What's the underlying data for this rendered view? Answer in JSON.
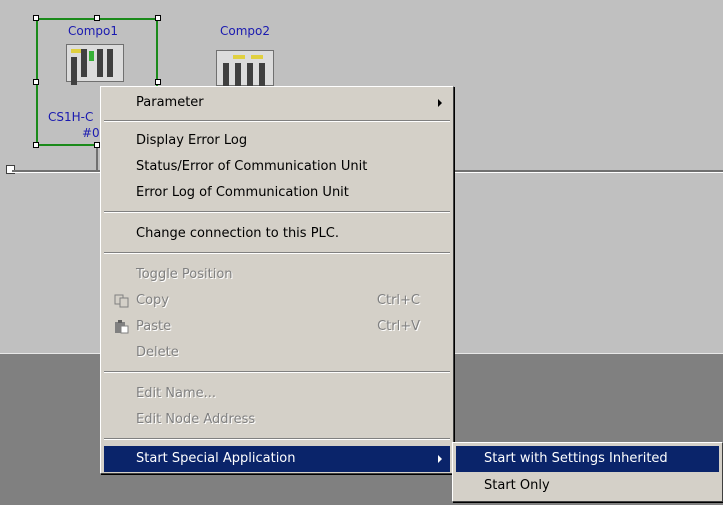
{
  "nodes": {
    "compo1": {
      "name": "Compo1",
      "model": "CS1H-C",
      "address": "#0"
    },
    "compo2": {
      "name": "Compo2"
    }
  },
  "context_menu": {
    "items": [
      {
        "label": "Parameter",
        "submenu": true,
        "enabled": true
      },
      {
        "label": "Display Error Log",
        "enabled": true
      },
      {
        "label": "Status/Error of Communication Unit",
        "enabled": true
      },
      {
        "label": "Error Log of Communication Unit",
        "enabled": true
      },
      {
        "label": "Change connection to this PLC.",
        "enabled": true
      },
      {
        "label": "Toggle Position",
        "enabled": false
      },
      {
        "label": "Copy",
        "shortcut": "Ctrl+C",
        "icon": "copy-icon",
        "enabled": false
      },
      {
        "label": "Paste",
        "shortcut": "Ctrl+V",
        "icon": "paste-icon",
        "enabled": false
      },
      {
        "label": "Delete",
        "enabled": false
      },
      {
        "label": "Edit Name...",
        "enabled": false
      },
      {
        "label": "Edit Node Address",
        "enabled": false
      },
      {
        "label": "Start Special Application",
        "submenu": true,
        "enabled": true,
        "highlighted": true
      }
    ]
  },
  "submenu": {
    "items": [
      {
        "label": "Start with Settings Inherited",
        "highlighted": true
      },
      {
        "label": "Start Only"
      }
    ]
  },
  "colors": {
    "highlight": "#0a246a",
    "selection_border": "#1a8a1a",
    "node_text": "#1a1ab0"
  }
}
